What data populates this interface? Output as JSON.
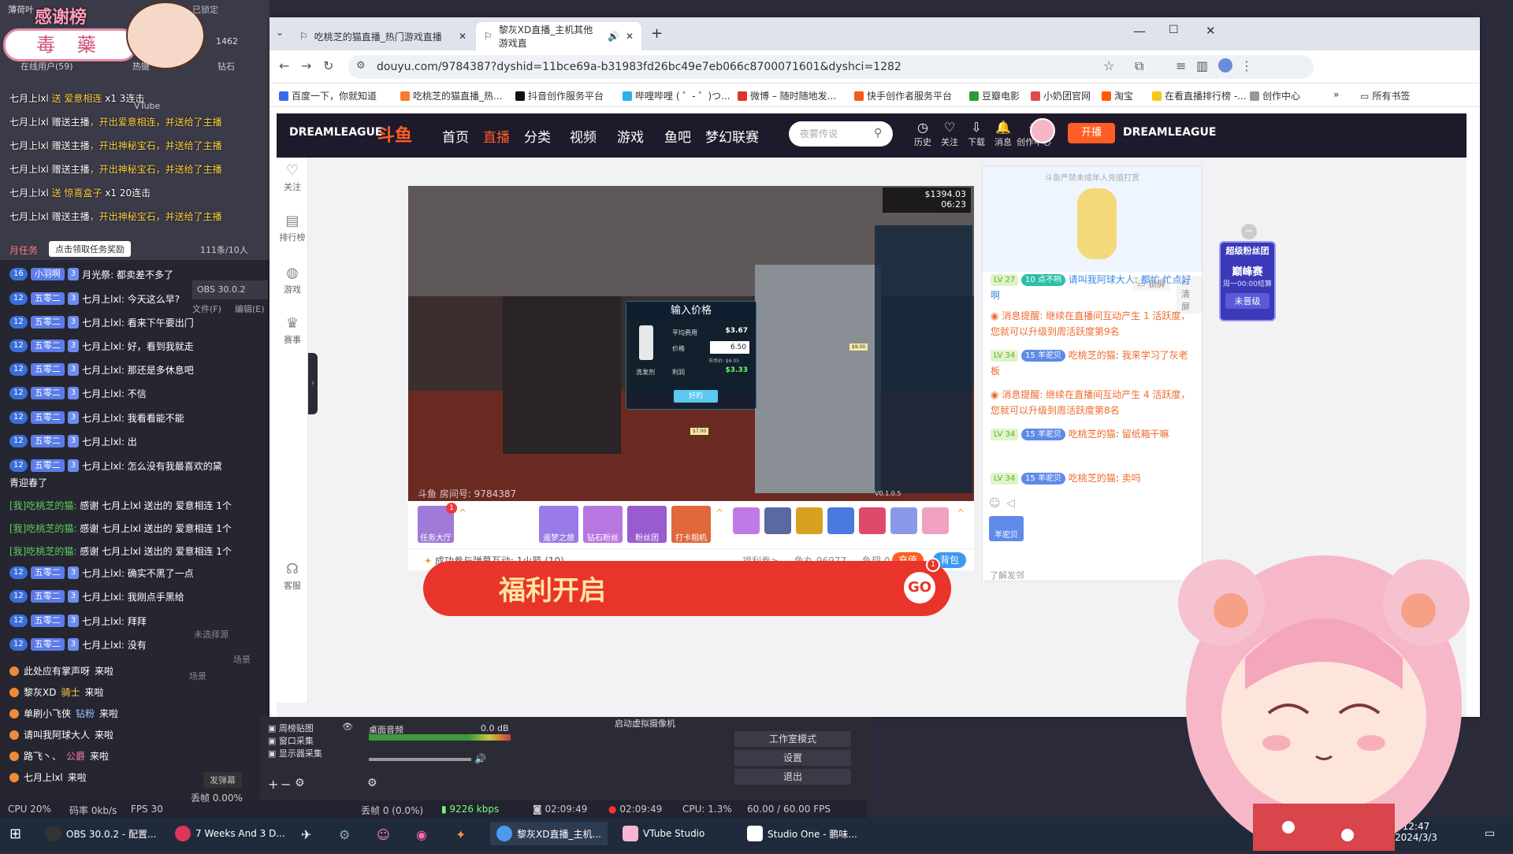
{
  "overlay": {
    "title_small": "薄荷叶",
    "logo_text": "毒 藥",
    "banner": "感谢榜",
    "locked": "已锁定",
    "top_count": "1462",
    "online": "在线用户(59)",
    "label_hotkey": "热键",
    "label_vtube": "VTube",
    "label_slots": "钻石",
    "gift_lines": [
      {
        "user": "七月上lxl",
        "action": "送 爱意相连",
        "count": "x1 3连击"
      },
      {
        "user": "七月上lxl",
        "action": "赠送主播",
        "extra": "，开出爱意相连，并送给了主播"
      },
      {
        "user": "七月上lxl",
        "action": "赠送主播",
        "extra": "，开出神秘宝石，并送给了主播"
      },
      {
        "user": "七月上lxl",
        "action": "赠送主播",
        "extra": "，开出神秘宝石，并送给了主播"
      },
      {
        "user": "七月上lxl",
        "action": "送 惊喜盒子",
        "count": "x1 20连击"
      },
      {
        "user": "七月上lxl",
        "action": "赠送主播",
        "extra": "，开出神秘宝石，并送给了主播"
      }
    ],
    "task_label": "月任务",
    "task_button": "点击领取任务奖励",
    "task_count": "111条/10人",
    "chat": [
      {
        "lv": "16",
        "user": "小羽啊",
        "fan": "3",
        "text": "月光祭: 都卖差不多了"
      },
      {
        "lv": "12",
        "user": "五零二",
        "fan": "3",
        "text": "七月上lxl: 今天这么早?"
      },
      {
        "lv": "12",
        "user": "五零二",
        "fan": "3",
        "text": "七月上lxl: 看来下午要出门"
      },
      {
        "lv": "12",
        "user": "五零二",
        "fan": "3",
        "text": "七月上lxl: 好，看到我就走"
      },
      {
        "lv": "12",
        "user": "五零二",
        "fan": "3",
        "text": "七月上lxl: 那还是多休息吧"
      },
      {
        "lv": "12",
        "user": "五零二",
        "fan": "3",
        "text": "七月上lxl: 不信"
      },
      {
        "lv": "12",
        "user": "五零二",
        "fan": "3",
        "text": "七月上lxl: 我看看能不能"
      },
      {
        "lv": "12",
        "user": "五零二",
        "fan": "3",
        "text": "七月上lxl: 出"
      },
      {
        "lv": "12",
        "user": "五零二",
        "fan": "3",
        "text": "七月上lxl: 怎么没有我最喜欢的黛"
      }
    ],
    "chat_wrap": "青迎春了",
    "sys": [
      {
        "tag": "[我]吃桃芝的猫:",
        "text": "感谢 七月上lxl 送出的 爱意相连 1个"
      },
      {
        "tag": "[我]吃桃芝的猫:",
        "text": "感谢 七月上lxl 送出的 爱意相连 1个"
      },
      {
        "tag": "[我]吃桃芝的猫:",
        "text": "感谢 七月上lxl 送出的 爱意相连 1个"
      }
    ],
    "chat2": [
      {
        "lv": "12",
        "user": "五零二",
        "fan": "3",
        "text": "七月上lxl: 确实不黑了一点"
      },
      {
        "lv": "12",
        "user": "五零二",
        "fan": "3",
        "text": "七月上lxl: 我刚点手黑给"
      },
      {
        "lv": "12",
        "user": "五零二",
        "fan": "3",
        "text": "七月上lxl: 拜拜"
      },
      {
        "lv": "12",
        "user": "五零二",
        "fan": "3",
        "text": "七月上lxl: 没有"
      }
    ],
    "enters": [
      {
        "user": "此处应有掌声呀",
        "text": "来啦"
      },
      {
        "user": "黎灰XD",
        "extra": "骑士",
        "text": "来啦"
      },
      {
        "user": "单刷小飞侠",
        "extra": "钻粉",
        "text": "来啦"
      },
      {
        "user": "请叫我阿球大人",
        "text": "来啦"
      },
      {
        "user": "路飞丶、",
        "extra": "公爵",
        "text": "来啦"
      },
      {
        "user": "七月上lxl",
        "text": "来啦"
      }
    ],
    "obs_popup": "OBS 30.0.2",
    "obs_file": "文件(F)",
    "obs_edit": "编辑(E)",
    "no_source": "未选择源",
    "scenes": "场景",
    "scene_header": "场景",
    "danmu_btn": "发弹幕"
  },
  "browser": {
    "tabs": [
      {
        "title": "吃桃芝的猫直播_热门游戏直播"
      },
      {
        "title": "黎灰XD直播_主机其他游戏直"
      }
    ],
    "url": "douyu.com/9784387?dyshid=11bce69a-b31983fd26bc49e7eb066c8700071601&dyshci=1282",
    "bookmarks": [
      "百度一下，你就知道",
      "吃桃芝的猫直播_热...",
      "抖音创作服务平台",
      "哔哩哔哩 ( ゜- ゜)つ...",
      "微博 – 随时随地发...",
      "快手创作者服务平台",
      "豆瓣电影",
      "小奶团官网",
      "淘宝",
      "在看直播排行榜 -...",
      "创作中心"
    ],
    "bookmarks_folder": "所有书签"
  },
  "site": {
    "brand_left": "DREAMLEAGUE",
    "logo": "斗鱼",
    "nav": [
      "首页",
      "直播",
      "分类",
      "视频",
      "游戏",
      "鱼吧",
      "梦幻联赛"
    ],
    "search_placeholder": "夜雾传说",
    "icons": [
      {
        "label": "历史",
        "icon": "clock-icon"
      },
      {
        "label": "关注",
        "icon": "heart-icon"
      },
      {
        "label": "下载",
        "icon": "download-icon"
      },
      {
        "label": "消息",
        "icon": "bell-icon"
      },
      {
        "label": "创作中心",
        "icon": "bulb-icon"
      }
    ],
    "live_button": "开播",
    "brand_right": "DREAMLEAGUE",
    "sidebar": [
      {
        "label": "关注",
        "icon": "heart-icon"
      },
      {
        "label": "排行榜",
        "icon": "rank-icon"
      },
      {
        "label": "游戏",
        "icon": "game-icon"
      },
      {
        "label": "赛事",
        "icon": "trophy-icon"
      },
      {
        "label": "客服",
        "icon": "headset-icon"
      }
    ]
  },
  "player": {
    "money": "$1394.03",
    "time": "06:23",
    "room": "斗鱼 房间号: 9784387",
    "dialog": {
      "title": "输入价格",
      "avg_cost_label": "平均费用",
      "avg_cost": "$3.67",
      "price_label": "价格",
      "price": "6.50",
      "market_label": "市场价: $6.05",
      "profit_label": "利润",
      "profit": "$3.33",
      "item": "洗发剂",
      "ok": "好的"
    },
    "price_tag": "$7.00",
    "version": "V0.1.0.5",
    "pricetag2": "$9.00"
  },
  "giftbar": {
    "items": [
      "任务大厅",
      "遥梦之旅",
      "钻石粉丝",
      "粉丝团",
      "打卡相机"
    ],
    "interact": "成功参与弹幕互动: 1火箭 (10)",
    "welfare": "福利券>",
    "fishball_label": "鱼丸",
    "fishball": "96977",
    "fishwing_label": "鱼翅",
    "fishwing": "0",
    "recharge": "充值",
    "backpack": "背包"
  },
  "chatpanel": {
    "notice": "斗鱼严禁未成年人充值打赏",
    "lock": "锁屏",
    "clear": "清屏",
    "msgs": [
      {
        "lv": "LV 27",
        "fan": "10 点不咧",
        "user": "请叫我阿球大人",
        "text": "都忙 忙点好啊"
      },
      {
        "type": "sys",
        "text": "消息提醒: 继续在直播间互动产生 1 活跃度，您就可以升级到周活跃度第9名"
      },
      {
        "lv": "LV 34",
        "fan": "15 羊驼贝",
        "user": "吃桃芝的猫",
        "text": "我来学习了灰老板"
      },
      {
        "type": "sys",
        "text": "消息提醒: 继续在直播间互动产生 4 活跃度，您就可以升级到周活跃度第8名"
      },
      {
        "lv": "LV 34",
        "fan": "15 羊驼贝",
        "user": "吃桃芝的猫",
        "text": "留纸箱干嘛"
      },
      {
        "lv": "LV 34",
        "fan": "15 羊驼贝",
        "user": "吃桃芝的猫",
        "text": "卖吗"
      }
    ],
    "bottom_label": "羊驼贝",
    "learn": "了解发邻"
  },
  "fanclub": {
    "title": "超级粉丝团",
    "event": "巅峰赛",
    "period": "周一00:00结算",
    "status": "未晋级"
  },
  "banner": {
    "text": "福利开启",
    "go": "GO",
    "badge": "1"
  },
  "obs": {
    "sources": [
      "周榜贴图",
      "窗口采集",
      "显示器采集"
    ],
    "audio_label": "桌面音频",
    "audio_db": "0.0 dB",
    "virtual_cam": "启动虚拟摄像机",
    "studio_mode": "工作室模式",
    "settings": "设置",
    "exit": "退出"
  },
  "status": {
    "dropped": "丢帧 0 (0.0%)",
    "kbps": "9226 kbps",
    "time1": "02:09:49",
    "time2": "02:09:49",
    "cpu": "CPU: 1.3%",
    "fps": "60.00 / 60.00 FPS",
    "cpu_left": "CPU 20%",
    "net": "码率 0kb/s",
    "fps_left": "FPS 30",
    "drop_left": "丢帧 0.00%"
  },
  "taskbar": {
    "apps": [
      "OBS 30.0.2 - 配置...",
      "7 Weeks And 3 D...",
      "黎灰XD直播_主机...",
      "VTube Studio",
      "Studio One - 鹏味..."
    ],
    "time": "12:47",
    "date": "2024/3/3"
  },
  "colors": {
    "douyu_orange": "#ff5d23",
    "nav_bg": "#1e1a2b",
    "accent_blue": "#5e8ae8"
  }
}
